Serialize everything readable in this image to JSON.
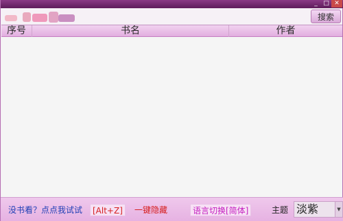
{
  "window": {
    "controls": {
      "minimize": "_",
      "maximize": "□",
      "close": "✕"
    }
  },
  "search": {
    "value": "",
    "placeholder": "",
    "button_label": "搜索"
  },
  "table": {
    "columns": [
      {
        "key": "seq",
        "label": "序号"
      },
      {
        "key": "title",
        "label": "书名"
      },
      {
        "key": "author",
        "label": "作者"
      }
    ],
    "rows": []
  },
  "footer": {
    "no_book_link": "没书看？点点我试试",
    "hotkey": "[Alt+Z]",
    "hide_all": "一键隐藏",
    "language_switch": "语言切换[简体]",
    "theme_label": "主题",
    "theme_value": "淡紫"
  },
  "colors": {
    "accent": "#e6b2e2",
    "titlebar": "#6e2a6b",
    "link_blue": "#1f3fb5",
    "hotkey_red": "#d61f1f",
    "lang_magenta": "#c41fc0"
  }
}
